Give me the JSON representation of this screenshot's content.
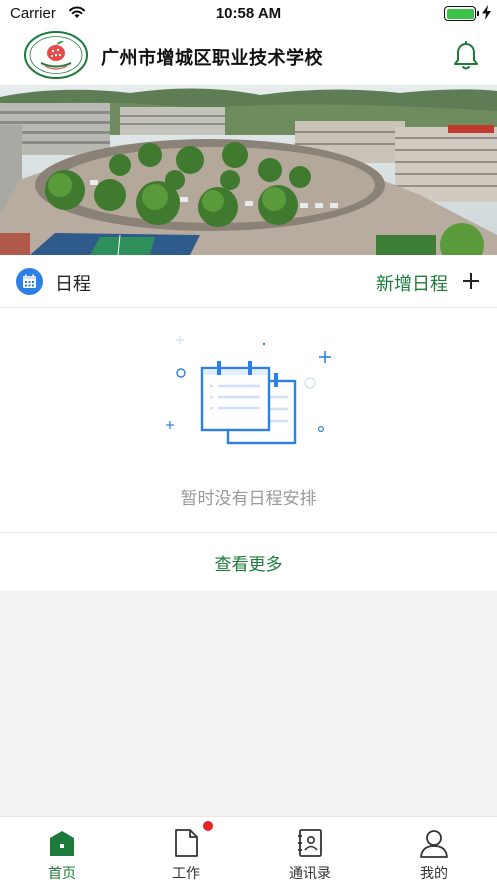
{
  "status_bar": {
    "carrier": "Carrier",
    "time": "10:58 AM",
    "battery_level": 1.0
  },
  "header": {
    "school_name": "广州市增城区职业技术学校",
    "logo_icon": "school-emblem-icon",
    "notification_icon": "bell-icon"
  },
  "banner": {
    "image": "campus-aerial-photo"
  },
  "schedule": {
    "title": "日程",
    "add_label": "新增日程",
    "empty_text": "暂时没有日程安排",
    "view_more_label": "查看更多"
  },
  "tabs": [
    {
      "label": "首页",
      "icon": "home-icon",
      "active": true
    },
    {
      "label": "工作",
      "icon": "document-icon",
      "active": false,
      "badge": true
    },
    {
      "label": "通讯录",
      "icon": "contacts-icon",
      "active": false
    },
    {
      "label": "我的",
      "icon": "profile-icon",
      "active": false
    }
  ],
  "colors": {
    "accent_green": "#1d7a3b",
    "calendar_blue": "#2d80e6",
    "badge_red": "#e8232a",
    "empty_text_grey": "#999999"
  }
}
